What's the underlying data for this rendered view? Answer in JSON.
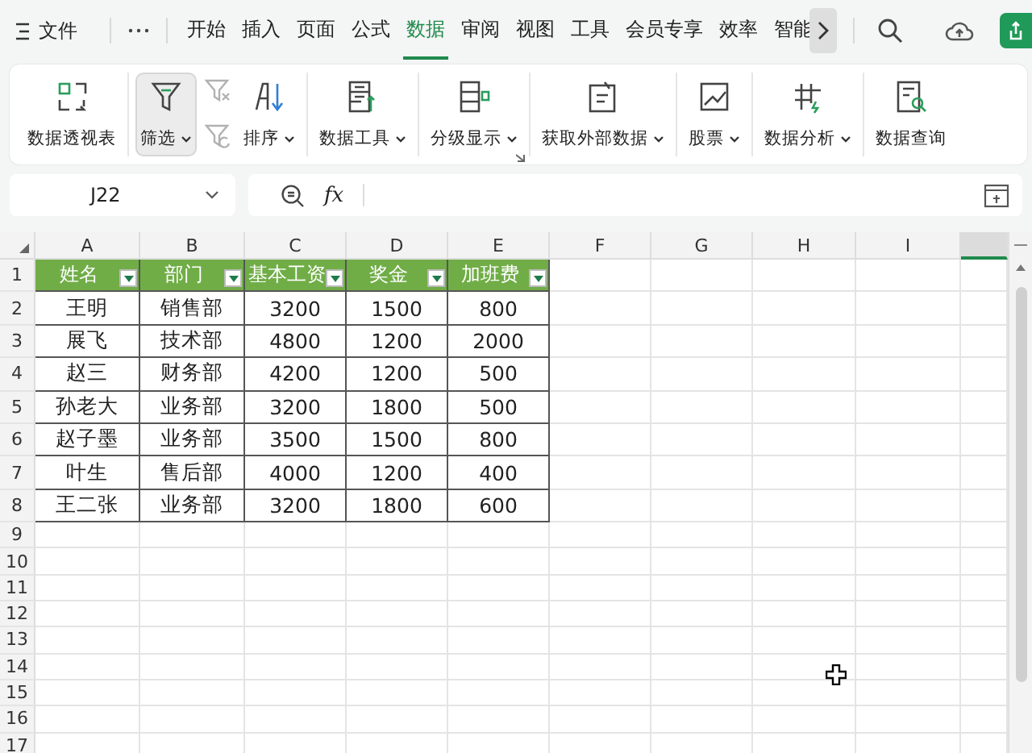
{
  "menu_bar": {
    "file_label": "文件",
    "tabs": [
      {
        "label": "开始",
        "selected": false
      },
      {
        "label": "插入",
        "selected": false
      },
      {
        "label": "页面",
        "selected": false
      },
      {
        "label": "公式",
        "selected": false
      },
      {
        "label": "数据",
        "selected": true
      },
      {
        "label": "审阅",
        "selected": false
      },
      {
        "label": "视图",
        "selected": false
      },
      {
        "label": "工具",
        "selected": false
      },
      {
        "label": "会员专享",
        "selected": false
      },
      {
        "label": "效率",
        "selected": false
      },
      {
        "label": "智能",
        "selected": false
      }
    ]
  },
  "ribbon": {
    "groups": [
      {
        "buttons": [
          {
            "kind": "large",
            "label": "数据透视表",
            "selected": false
          }
        ]
      },
      {
        "buttons": [
          {
            "kind": "large",
            "label": "筛选",
            "dropdown": true,
            "selected": true
          },
          {
            "kind": "stack",
            "disabled": true
          },
          {
            "kind": "large",
            "label": "排序",
            "dropdown": true,
            "selected": false
          }
        ]
      },
      {
        "buttons": [
          {
            "kind": "large",
            "label": "数据工具",
            "dropdown": true,
            "selected": false
          }
        ]
      },
      {
        "launcher": true,
        "buttons": [
          {
            "kind": "large",
            "label": "分级显示",
            "dropdown": true,
            "selected": false
          }
        ]
      },
      {
        "buttons": [
          {
            "kind": "large",
            "label": "获取外部数据",
            "dropdown": true,
            "selected": false
          }
        ]
      },
      {
        "buttons": [
          {
            "kind": "large",
            "label": "股票",
            "dropdown": true,
            "selected": false
          }
        ]
      },
      {
        "buttons": [
          {
            "kind": "large",
            "label": "数据分析",
            "dropdown": true,
            "selected": false
          }
        ]
      },
      {
        "buttons": [
          {
            "kind": "large",
            "label": "数据查询",
            "selected": false
          }
        ]
      }
    ]
  },
  "formula_bar": {
    "name_box": "J22",
    "fx_label": "fx"
  },
  "sheet": {
    "columns": [
      {
        "label": "A",
        "selected": false
      },
      {
        "label": "B",
        "selected": false
      },
      {
        "label": "C",
        "selected": false
      },
      {
        "label": "D",
        "selected": false
      },
      {
        "label": "E",
        "selected": false
      },
      {
        "label": "F",
        "selected": false
      },
      {
        "label": "G",
        "selected": false
      },
      {
        "label": "H",
        "selected": false
      },
      {
        "label": "I",
        "selected": false
      },
      {
        "selected": true
      }
    ],
    "row_numbers": [
      "1",
      "2",
      "3",
      "4",
      "5",
      "6",
      "7",
      "8",
      "9",
      "10",
      "11",
      "12",
      "13",
      "14",
      "15",
      "16",
      "17"
    ],
    "table": {
      "columns": [
        "姓名",
        "部门",
        "基本工资",
        "奖金",
        "加班费"
      ],
      "rows": [
        [
          "王明",
          "销售部",
          "3200",
          "1500",
          "800"
        ],
        [
          "展飞",
          "技术部",
          "4800",
          "1200",
          "2000"
        ],
        [
          "赵三",
          "财务部",
          "4200",
          "1200",
          "500"
        ],
        [
          "孙老大",
          "业务部",
          "3200",
          "1800",
          "500"
        ],
        [
          "赵子墨",
          "业务部",
          "3500",
          "1500",
          "800"
        ],
        [
          "叶生",
          "售后部",
          "4000",
          "1200",
          "400"
        ],
        [
          "王二张",
          "业务部",
          "3200",
          "1800",
          "600"
        ]
      ]
    }
  }
}
